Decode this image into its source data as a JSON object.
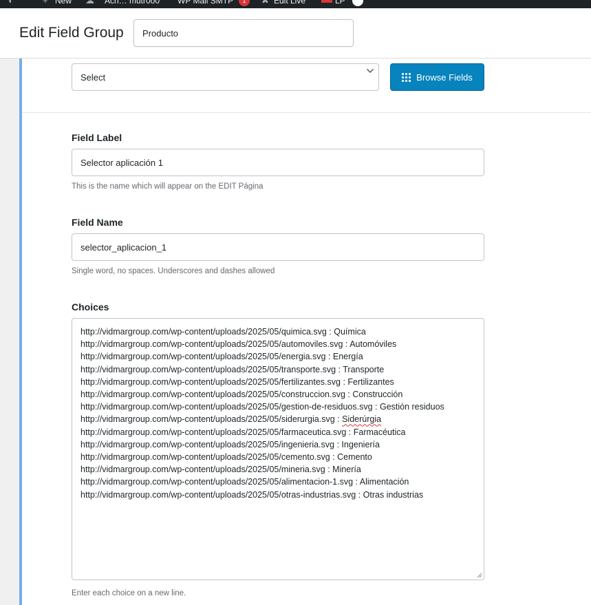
{
  "admin_bar": {
    "new_label": "New",
    "item2_label": "Acn… mutr0o0",
    "item3_label": "WP Mail SMTP",
    "badge_count": "1",
    "item4_label": "Edit Live",
    "item5_label": "LP"
  },
  "header": {
    "title": "Edit Field Group",
    "group_name_value": "Producto"
  },
  "type_row": {
    "select_value": "Select",
    "browse_label": "Browse Fields"
  },
  "field_label": {
    "label": "Field Label",
    "value": "Selector aplicación 1",
    "help": "This is the name which will appear on the EDIT Página"
  },
  "field_name": {
    "label": "Field Name",
    "value": "selector_aplicacion_1",
    "help": "Single word, no spaces. Underscores and dashes allowed"
  },
  "choices": {
    "label": "Choices",
    "lines": [
      "http://vidmargroup.com/wp-content/uploads/2025/05/quimica.svg : Química",
      "http://vidmargroup.com/wp-content/uploads/2025/05/automoviles.svg : Automóviles",
      "http://vidmargroup.com/wp-content/uploads/2025/05/energia.svg : Energía",
      "http://vidmargroup.com/wp-content/uploads/2025/05/transporte.svg : Transporte",
      "http://vidmargroup.com/wp-content/uploads/2025/05/fertilizantes.svg : Fertilizantes",
      "http://vidmargroup.com/wp-content/uploads/2025/05/construccion.svg : Construcción",
      "http://vidmargroup.com/wp-content/uploads/2025/05/gestion-de-residuos.svg : Gestión residuos",
      "http://vidmargroup.com/wp-content/uploads/2025/05/siderurgia.svg : ",
      "http://vidmargroup.com/wp-content/uploads/2025/05/farmaceutica.svg : Farmacéutica",
      "http://vidmargroup.com/wp-content/uploads/2025/05/ingenieria.svg : Ingeniería",
      "http://vidmargroup.com/wp-content/uploads/2025/05/cemento.svg : Cemento",
      "http://vidmargroup.com/wp-content/uploads/2025/05/mineria.svg : Minería",
      "http://vidmargroup.com/wp-content/uploads/2025/05/alimentacion-1.svg : Alimentación",
      "http://vidmargroup.com/wp-content/uploads/2025/05/otras-industrias.svg : Otras industrias"
    ],
    "misspelled_word": "Siderúrgia",
    "help": "Enter each choice on a new line."
  },
  "colors": {
    "accent_blue": "#0783be",
    "panel_accent": "#72aee6",
    "admin_bar": "#1d2327",
    "spell_error": "#d63638"
  }
}
